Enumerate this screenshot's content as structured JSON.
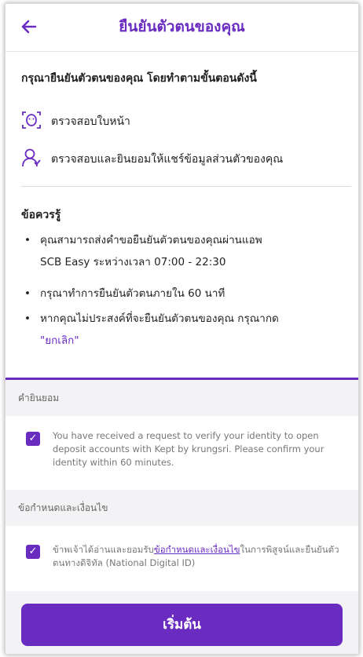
{
  "header": {
    "back_icon": "arrow-left-icon",
    "title": "ยืนยันตัวตนของคุณ"
  },
  "intro": "กรุณายืนยันตัวตนของคุณ โดยทำตามขั้นตอนดังนี้",
  "steps": [
    {
      "icon": "face-scan-icon",
      "label": "ตรวจสอบใบหน้า"
    },
    {
      "icon": "person-icon",
      "label": "ตรวจสอบและยินยอมให้แชร์ข้อมูลส่วนตัวของคุณ"
    }
  ],
  "notes": {
    "heading": "ข้อควรรู้",
    "items": [
      {
        "line1": "คุณสามารถส่งคำขอยืนยันตัวตนของคุณผ่านแอพ",
        "line2": "SCB Easy ระหว่างเวลา 07:00 - 22:30"
      },
      {
        "line1": "กรุณาทำการยืนยันตัวตนภายใน 60 นาที"
      },
      {
        "line1": "หากคุณไม่ประสงค์ที่จะยืนยันตัวตนของคุณ กรุณากด",
        "cancel_link": "\"ยกเลิก\""
      }
    ]
  },
  "consent": {
    "heading": "คำยินยอม",
    "checked": true,
    "text": "You have received a request to verify your identity to open deposit accounts with Kept by krungsri. Please confirm your identity within 60 minutes."
  },
  "terms": {
    "heading": "ข้อกำหนดและเงื่อนไข",
    "checked": true,
    "text_before": "ข้าพเจ้าได้อ่านและยอมรับ",
    "link": "ข้อกำหนดและเงื่อนไข",
    "text_after": "ในการพิสูจน์และยืนยันตัวตนทางดิจิทัล (National Digital ID)"
  },
  "button": {
    "label": "เริ่มต้น"
  },
  "colors": {
    "accent": "#6a2cc0",
    "section_bg": "#f3f3f5"
  }
}
